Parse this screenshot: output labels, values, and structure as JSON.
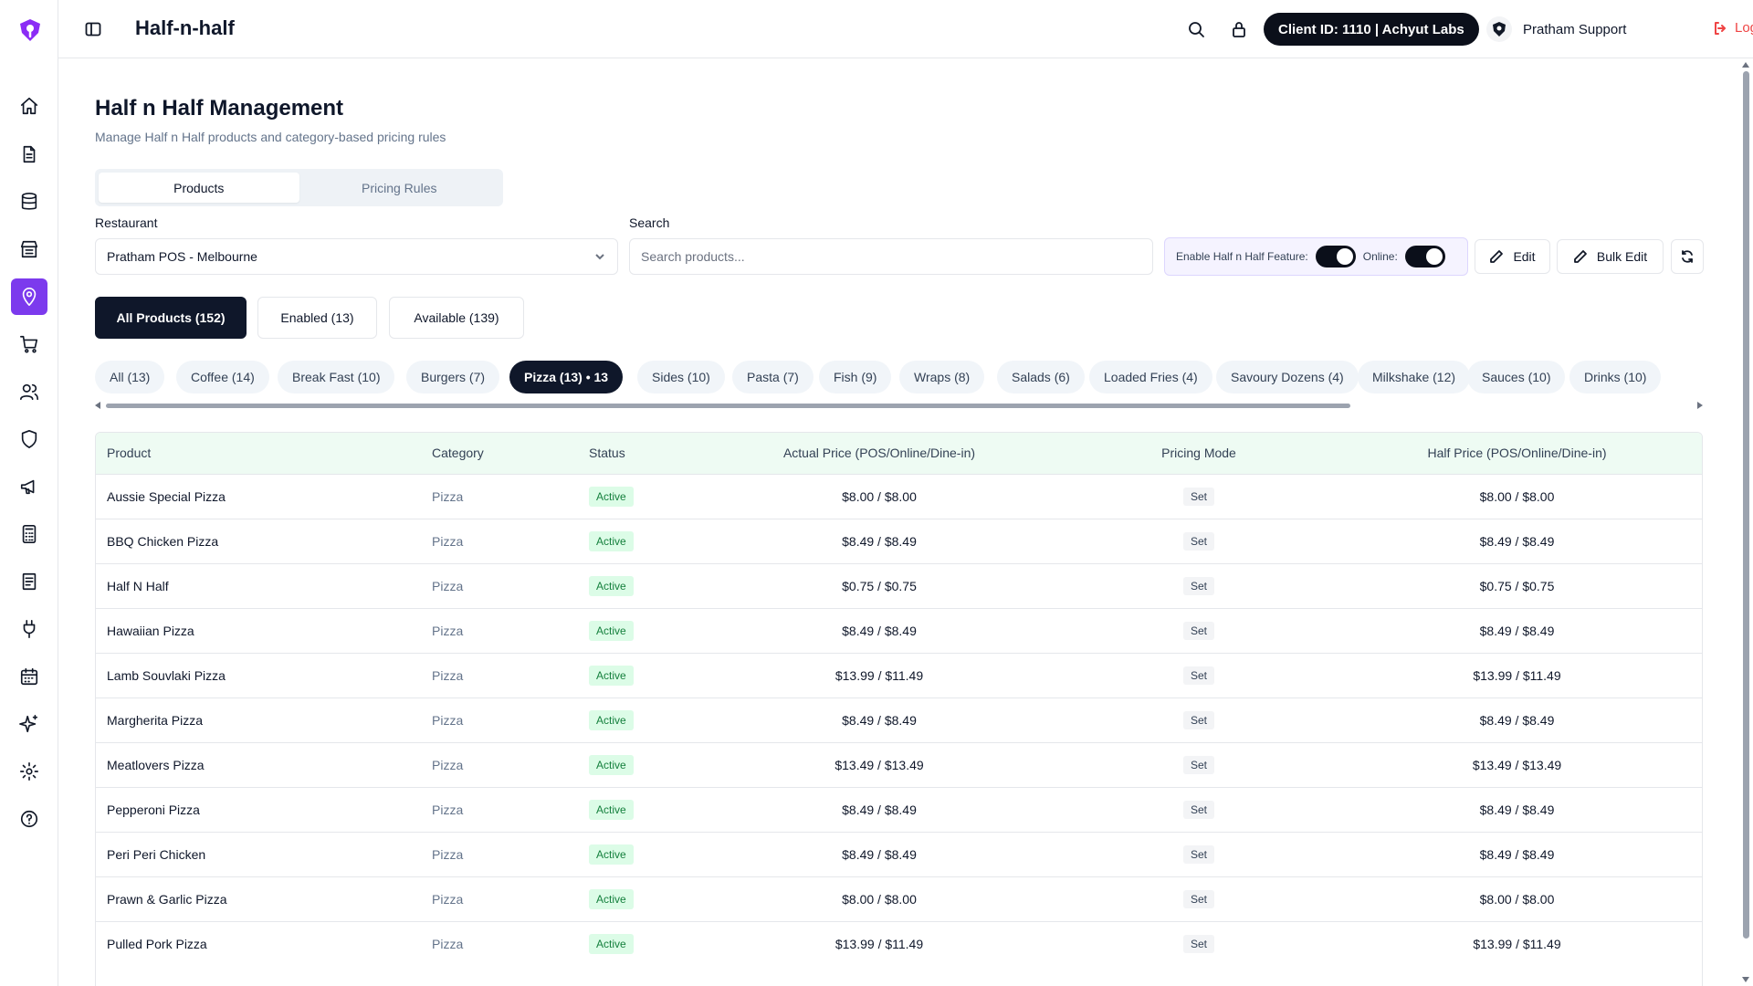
{
  "header": {
    "app_title": "Half-n-half",
    "client_id": "Client ID: 1110 | Achyut Labs",
    "user_name": "Pratham Support",
    "logout_label": "Logout"
  },
  "sidebar": {
    "items": [
      {
        "icon": "home-icon"
      },
      {
        "icon": "document-icon"
      },
      {
        "icon": "database-icon"
      },
      {
        "icon": "store-icon"
      },
      {
        "icon": "location-pin-icon",
        "active": true
      },
      {
        "icon": "cart-icon"
      },
      {
        "icon": "users-icon"
      },
      {
        "icon": "shield-icon"
      },
      {
        "icon": "megaphone-icon"
      },
      {
        "icon": "calculator-icon"
      },
      {
        "icon": "receipt-icon"
      },
      {
        "icon": "plug-icon"
      },
      {
        "icon": "calendar-icon"
      },
      {
        "icon": "sparkles-icon"
      },
      {
        "icon": "gear-icon"
      },
      {
        "icon": "help-icon"
      }
    ]
  },
  "page": {
    "title": "Half n Half Management",
    "subtitle": "Manage Half n Half products and category-based pricing rules",
    "tabs": [
      {
        "label": "Products",
        "active": true
      },
      {
        "label": "Pricing Rules",
        "active": false
      }
    ]
  },
  "filters": {
    "restaurant_label": "Restaurant",
    "restaurant_value": "Pratham POS - Melbourne",
    "search_label": "Search",
    "search_placeholder": "Search products...",
    "feature_label": "Enable Half n Half Feature:",
    "online_label": "Online:",
    "feature_enabled": true,
    "online_enabled": true,
    "edit_label": "Edit",
    "bulk_edit_label": "Bulk Edit"
  },
  "product_filters": [
    {
      "label": "All Products (152)",
      "active": true
    },
    {
      "label": "Enabled (13)",
      "active": false
    },
    {
      "label": "Available (139)",
      "active": false
    }
  ],
  "categories": [
    {
      "label": "All (13)"
    },
    {
      "label": "Coffee (14)"
    },
    {
      "label": "Break Fast (10)"
    },
    {
      "label": "Burgers (7)"
    },
    {
      "label": "Pizza (13) • 13",
      "active": true
    },
    {
      "label": "Sides (10)"
    },
    {
      "label": "Pasta (7)"
    },
    {
      "label": "Fish (9)"
    },
    {
      "label": "Wraps (8)"
    },
    {
      "label": "Salads (6)"
    },
    {
      "label": "Loaded Fries (4)"
    },
    {
      "label": "Savoury Dozens (4)"
    },
    {
      "label": "Milkshake (12)"
    },
    {
      "label": "Sauces (10)"
    },
    {
      "label": "Drinks (10)"
    }
  ],
  "table": {
    "columns": [
      "Product",
      "Category",
      "Status",
      "Actual Price (POS/Online/Dine-in)",
      "Pricing Mode",
      "Half Price (POS/Online/Dine-in)"
    ],
    "rows": [
      {
        "product": "Aussie Special Pizza",
        "category": "Pizza",
        "status": "Active",
        "actual": "$8.00 / $8.00",
        "mode": "Set",
        "half": "$8.00 / $8.00"
      },
      {
        "product": "BBQ Chicken Pizza",
        "category": "Pizza",
        "status": "Active",
        "actual": "$8.49 / $8.49",
        "mode": "Set",
        "half": "$8.49 / $8.49"
      },
      {
        "product": "Half N Half",
        "category": "Pizza",
        "status": "Active",
        "actual": "$0.75 / $0.75",
        "mode": "Set",
        "half": "$0.75 / $0.75"
      },
      {
        "product": "Hawaiian Pizza",
        "category": "Pizza",
        "status": "Active",
        "actual": "$8.49 / $8.49",
        "mode": "Set",
        "half": "$8.49 / $8.49"
      },
      {
        "product": "Lamb Souvlaki Pizza",
        "category": "Pizza",
        "status": "Active",
        "actual": "$13.99 / $11.49",
        "mode": "Set",
        "half": "$13.99 / $11.49"
      },
      {
        "product": "Margherita Pizza",
        "category": "Pizza",
        "status": "Active",
        "actual": "$8.49 / $8.49",
        "mode": "Set",
        "half": "$8.49 / $8.49"
      },
      {
        "product": "Meatlovers Pizza",
        "category": "Pizza",
        "status": "Active",
        "actual": "$13.49 / $13.49",
        "mode": "Set",
        "half": "$13.49 / $13.49"
      },
      {
        "product": "Pepperoni Pizza",
        "category": "Pizza",
        "status": "Active",
        "actual": "$8.49 / $8.49",
        "mode": "Set",
        "half": "$8.49 / $8.49"
      },
      {
        "product": "Peri Peri Chicken",
        "category": "Pizza",
        "status": "Active",
        "actual": "$8.49 / $8.49",
        "mode": "Set",
        "half": "$8.49 / $8.49"
      },
      {
        "product": "Prawn & Garlic Pizza",
        "category": "Pizza",
        "status": "Active",
        "actual": "$8.00 / $8.00",
        "mode": "Set",
        "half": "$8.00 / $8.00"
      },
      {
        "product": "Pulled Pork Pizza",
        "category": "Pizza",
        "status": "Active",
        "actual": "$13.99 / $11.49",
        "mode": "Set",
        "half": "$13.99 / $11.49"
      }
    ]
  }
}
